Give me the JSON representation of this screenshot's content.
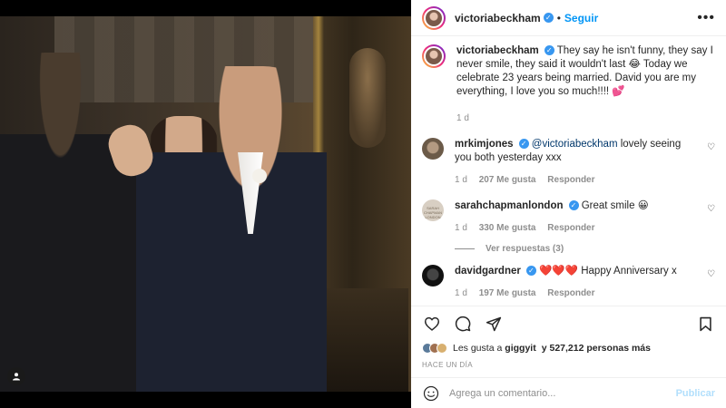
{
  "post": {
    "author": "victoriabeckham",
    "separator": "•",
    "follow_label": "Seguir",
    "more_label": "•••"
  },
  "caption": {
    "username": "victoriabeckham",
    "text": "They say he isn't funny, they say I never smile, they said it wouldn't last 😂 Today we celebrate 23 years being married. David you are my everything, I love you so much!!!! 💕",
    "time": "1 d"
  },
  "comments": [
    {
      "username": "mrkimjones",
      "mention": "@victoriabeckham",
      "text": "lovely seeing you both yesterday xxx",
      "time": "1 d",
      "likes": "207 Me gusta",
      "reply": "Responder"
    },
    {
      "username": "sarahchapmanlondon",
      "avatar_text": "SARAH CHAPMAN LONDON",
      "text": "Great smile 😀",
      "time": "1 d",
      "likes": "330 Me gusta",
      "reply": "Responder",
      "view_replies": "Ver respuestas (3)"
    },
    {
      "username": "davidgardner",
      "hearts": "❤️❤️❤️",
      "text": "Happy Anniversary x",
      "time": "1 d",
      "likes": "197 Me gusta",
      "reply": "Responder"
    }
  ],
  "likes": {
    "prefix": "Les gusta a",
    "user": "giggyit",
    "suffix": "y 527,212 personas más"
  },
  "time_ago": "HACE UN DÍA",
  "composer": {
    "placeholder": "Agrega un comentario...",
    "publish_label": "Publicar"
  },
  "colors": {
    "link_blue": "#0095f6",
    "verified_blue": "#3897f0",
    "publish_disabled": "#b2dffc"
  }
}
